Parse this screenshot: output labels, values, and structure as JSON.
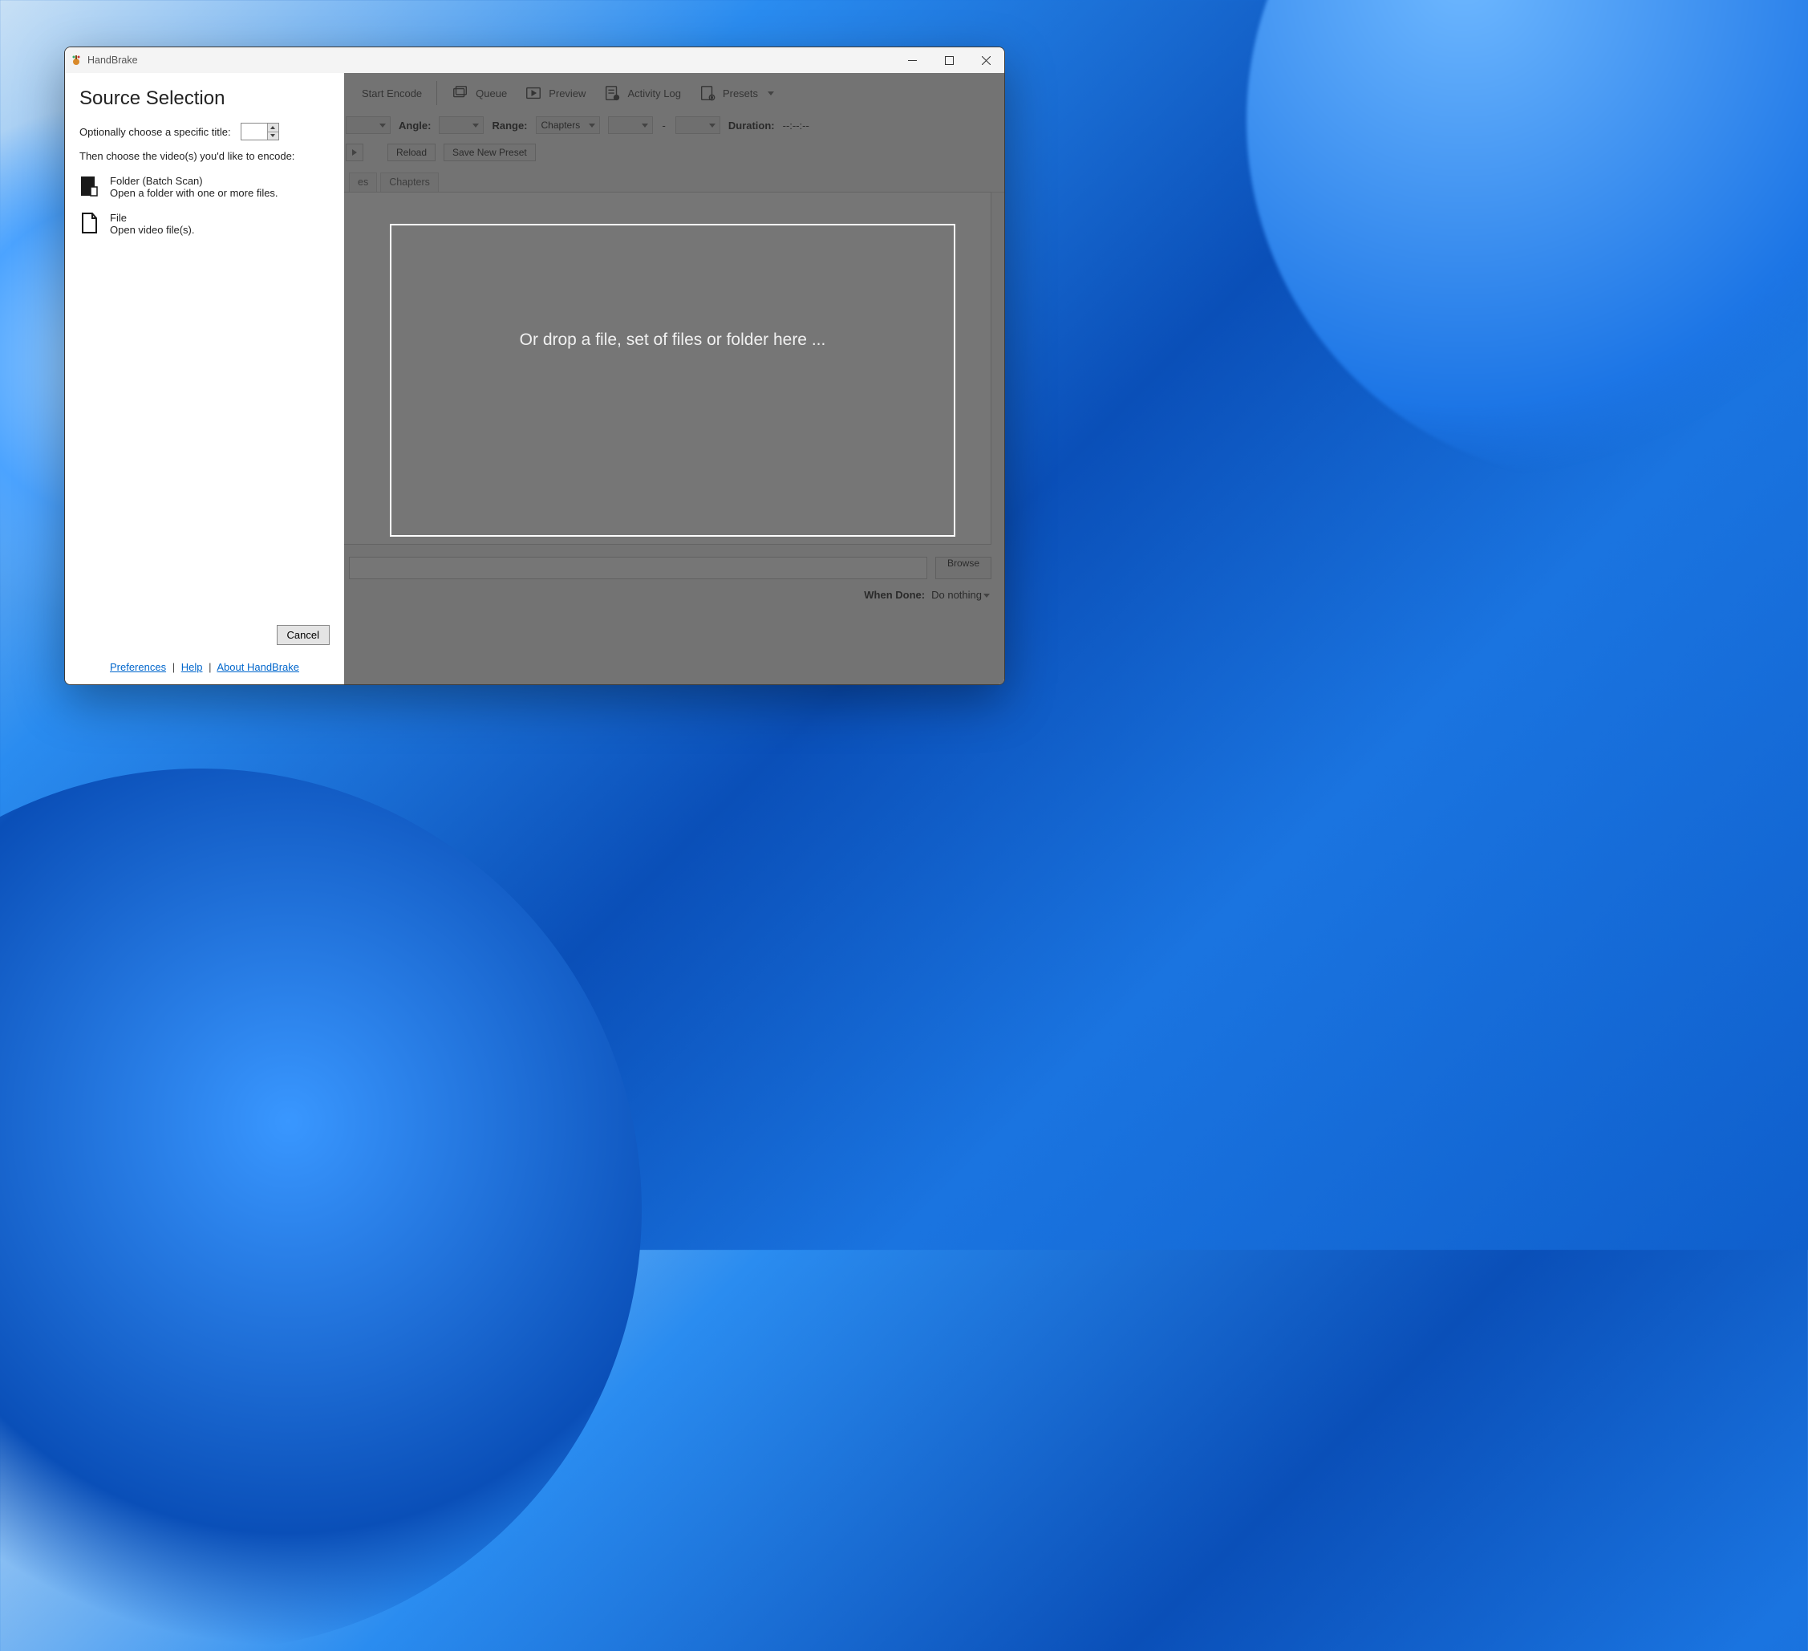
{
  "window": {
    "title": "HandBrake"
  },
  "titlebar_controls": {
    "min": "minimize",
    "max": "maximize",
    "close": "close"
  },
  "toolbar": {
    "start_encode": "Start Encode",
    "queue": "Queue",
    "preview": "Preview",
    "activity_log": "Activity Log",
    "presets": "Presets"
  },
  "fields": {
    "angle_label": "Angle:",
    "range_label": "Range:",
    "range_value": "Chapters",
    "dash": "-",
    "duration_label": "Duration:",
    "duration_value": "--:--:--"
  },
  "buttons": {
    "reload": "Reload",
    "save_preset": "Save New Preset",
    "browse": "Browse"
  },
  "tabs": {
    "t1": "es",
    "t2": "Chapters"
  },
  "status": {
    "when_done_label": "When Done:",
    "when_done_value": "Do nothing"
  },
  "panel": {
    "title": "Source Selection",
    "opt_label": "Optionally choose a specific title:",
    "hint": "Then choose the video(s) you'd like to encode:",
    "folder_title": "Folder (Batch Scan)",
    "folder_desc": "Open a folder with one or more files.",
    "file_title": "File",
    "file_desc": "Open video file(s).",
    "cancel": "Cancel",
    "prefs": "Preferences",
    "help": "Help",
    "about": "About HandBrake",
    "sep": "|"
  },
  "dropzone": {
    "text": "Or drop a file, set of files or folder here ..."
  }
}
